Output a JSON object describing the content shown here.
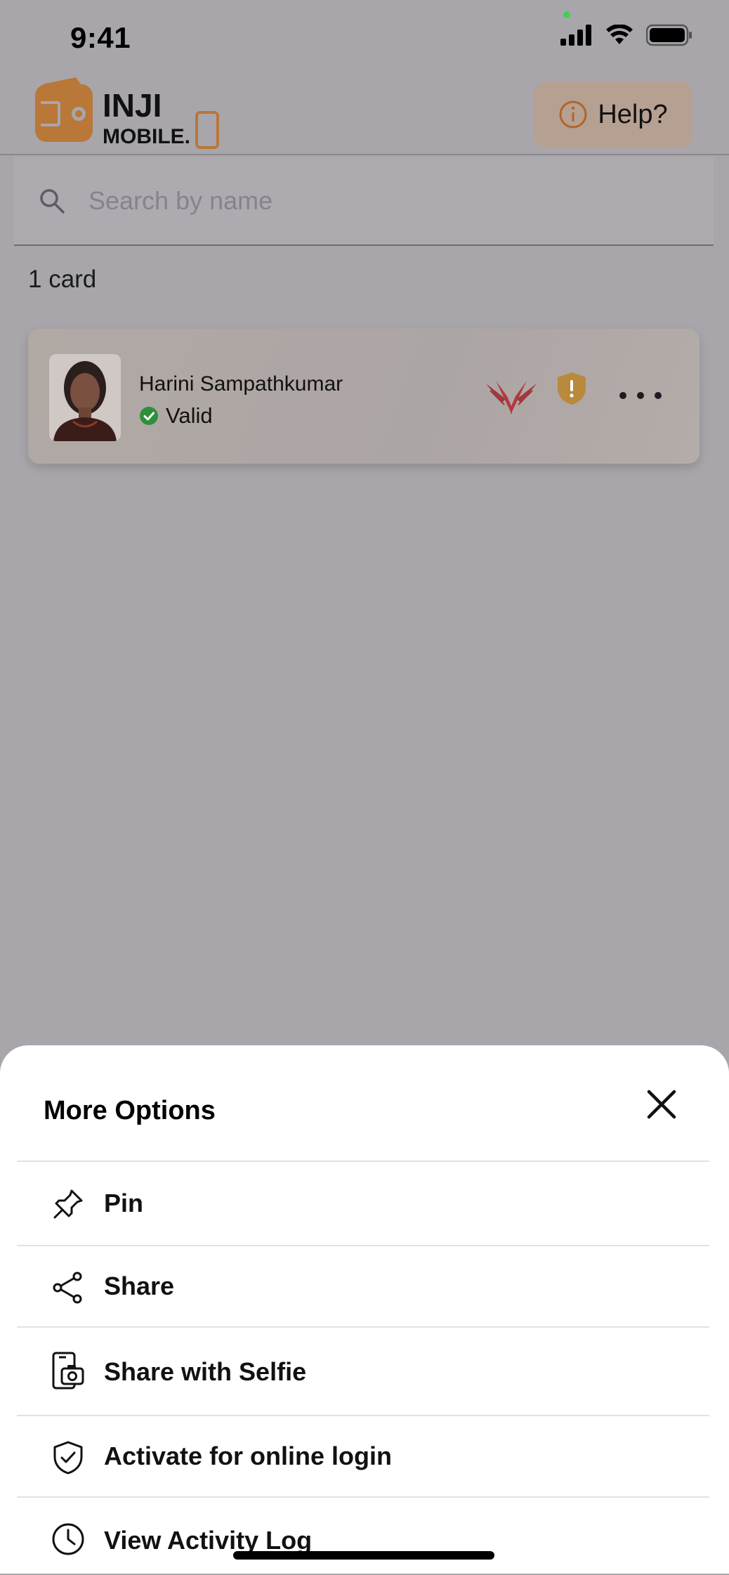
{
  "status_bar": {
    "time": "9:41"
  },
  "header": {
    "logo_text_top": "INJI",
    "logo_text_bottom": "MOBILE.",
    "help_label": "Help?"
  },
  "search": {
    "placeholder": "Search by name"
  },
  "card_count": "1 card",
  "card": {
    "name": "Harini Sampathkumar",
    "status": "Valid"
  },
  "sheet": {
    "title": "More Options",
    "items": [
      {
        "label": "Pin",
        "icon": "pin-icon"
      },
      {
        "label": "Share",
        "icon": "share-icon"
      },
      {
        "label": "Share with Selfie",
        "icon": "share-selfie-icon"
      },
      {
        "label": "Activate for online login",
        "icon": "shield-check-icon"
      },
      {
        "label": "View Activity Log",
        "icon": "clock-icon"
      }
    ]
  },
  "colors": {
    "overlay_bg": "#a9a6ab",
    "brand_orange": "#c0702a",
    "valid_green": "#2f8f3a",
    "sheet_bg": "#ffffff"
  }
}
